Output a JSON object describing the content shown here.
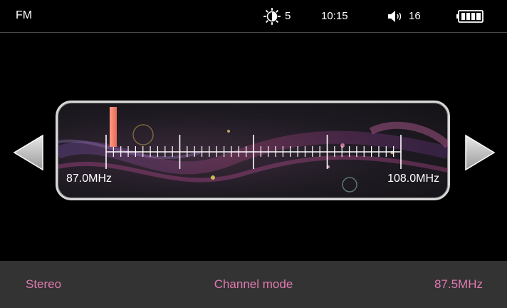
{
  "status": {
    "app_title": "FM",
    "brightness": "5",
    "time": "10:15",
    "volume": "16",
    "brightness_icon": "brightness-icon",
    "volume_icon": "speaker-icon",
    "battery_icon": "battery-full-icon"
  },
  "tuner": {
    "min_label": "87.0MHz",
    "max_label": "108.0MHz",
    "min_mhz": 87.0,
    "max_mhz": 108.0,
    "current_mhz": 87.5
  },
  "bottom": {
    "audio_mode": "Stereo",
    "mode": "Channel mode",
    "frequency": "87.5MHz"
  },
  "colors": {
    "accent_text": "#e07ab0",
    "needle": "#e96a5a",
    "bottom_bar": "#333333"
  }
}
